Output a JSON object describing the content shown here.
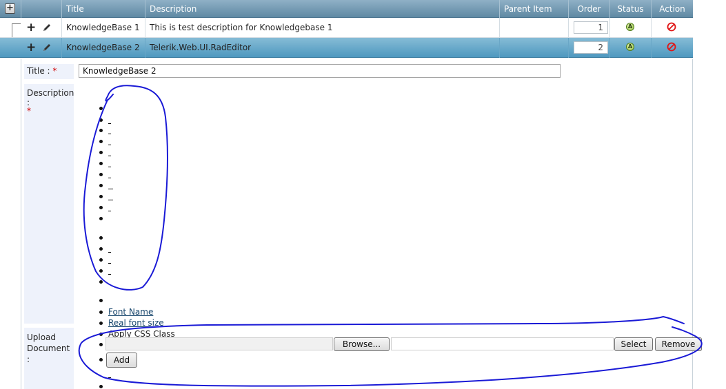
{
  "grid": {
    "columns": {
      "title": "Title",
      "description": "Description",
      "parent_item": "Parent Item",
      "order": "Order",
      "status": "Status",
      "action": "Action"
    },
    "rows": [
      {
        "title": "KnowledgeBase 1",
        "description": "This is test description for Knowledgebase 1",
        "parent_item": "",
        "order": "1",
        "status_icon": "A"
      },
      {
        "title": "KnowledgeBase 2",
        "description": "Telerik.Web.UI.RadEditor",
        "parent_item": "",
        "order": "2",
        "status_icon": "A"
      }
    ],
    "selected_row_color": "#4e98bf",
    "header_color": "#6f95ad"
  },
  "form": {
    "title_label": "Title :",
    "required_mark": "*",
    "title_value": "KnowledgeBase 2",
    "description_label": "Description :",
    "description_required": "*",
    "description_links": {
      "font_name": "Font Name",
      "real_font_size": "Real font size",
      "apply_css_class": "Apply CSS Class"
    },
    "upload_label_1": "Upload",
    "upload_label_2": "Document :",
    "browse_button": "Browse...",
    "select_button": "Select",
    "remove_button": "Remove",
    "add_button": "Add"
  },
  "annotation_color": "#1a1ad6"
}
